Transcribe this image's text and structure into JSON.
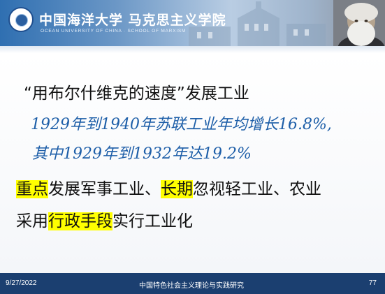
{
  "header": {
    "logo_cn": "中国海洋大学 马克思主义学院",
    "logo_en": "OCEAN UNIVERSITY OF CHINA   ·   SCHOOL OF MARXISM"
  },
  "slide": {
    "title": "“用布尔什维克的速度”发展工业",
    "blue_line1": "1929年到1940年苏联工业年均增长16.8%,",
    "blue_line2": "其中1929年到1932年达19.2%",
    "line1": {
      "hl1": "重点",
      "text1": "发展军事工业、",
      "hl2": "长期",
      "text2": "忽视轻工业、农业"
    },
    "line2": {
      "text1": "采用",
      "hl1": "行政手段",
      "text2": "实行工业化"
    }
  },
  "footer": {
    "date": "9/27/2022",
    "course": "中国特色社会主义理论与实践研究",
    "page": "77"
  },
  "colors": {
    "header_blue": "#2f6fb1",
    "footer_navy": "#1b3f70",
    "highlight": "#ffff00",
    "accent_text_blue": "#1d5ea8"
  }
}
